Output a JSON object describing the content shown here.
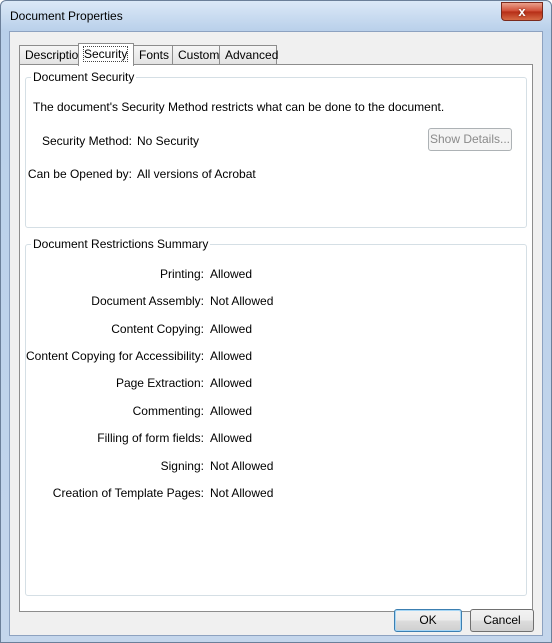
{
  "window": {
    "title": "Document Properties",
    "close_glyph": "x"
  },
  "tabs": [
    {
      "label": "Description"
    },
    {
      "label": "Security"
    },
    {
      "label": "Fonts"
    },
    {
      "label": "Custom"
    },
    {
      "label": "Advanced"
    }
  ],
  "security": {
    "group_title": "Document Security",
    "intro": "The document's Security Method restricts what can be done to the document.",
    "method_label": "Security Method:",
    "method_value": "No Security",
    "show_details_label": "Show Details...",
    "opened_by_label": "Can be Opened by:",
    "opened_by_value": "All versions of Acrobat"
  },
  "restrictions": {
    "group_title": "Document Restrictions Summary",
    "items": [
      {
        "label": "Printing:",
        "value": "Allowed"
      },
      {
        "label": "Document Assembly:",
        "value": "Not Allowed"
      },
      {
        "label": "Content Copying:",
        "value": "Allowed"
      },
      {
        "label": "Content Copying for Accessibility:",
        "value": "Allowed"
      },
      {
        "label": "Page Extraction:",
        "value": "Allowed"
      },
      {
        "label": "Commenting:",
        "value": "Allowed"
      },
      {
        "label": "Filling of form fields:",
        "value": "Allowed"
      },
      {
        "label": "Signing:",
        "value": "Not Allowed"
      },
      {
        "label": "Creation of Template Pages:",
        "value": "Not Allowed"
      }
    ]
  },
  "footer": {
    "ok_label": "OK",
    "cancel_label": "Cancel"
  }
}
